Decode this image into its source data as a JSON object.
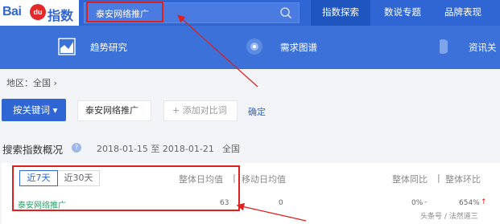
{
  "brand": {
    "bai": "Bai",
    "du": "du",
    "zhishu": "指数"
  },
  "search": {
    "value": "泰安网络推广"
  },
  "topnav": [
    {
      "label": "指数探索"
    },
    {
      "label": "数说专题"
    },
    {
      "label": "品牌表现"
    }
  ],
  "subnav": [
    {
      "label": "趋势研究"
    },
    {
      "label": "需求图谱"
    },
    {
      "label": "资讯关"
    }
  ],
  "region": {
    "label": "地区：全国 ›"
  },
  "controls": {
    "keyword_button": "按关键词 ▾",
    "keyword_chip": "泰安网络推广",
    "add_compare": "+ 添加对比词",
    "confirm": "确定"
  },
  "overview": {
    "title": "搜索指数概况",
    "date_range": "2018-01-15 至 2018-01-21",
    "area": "全国"
  },
  "table": {
    "tabs": [
      "近7天",
      "近30天"
    ],
    "headers": [
      "整体日均值",
      "|",
      "移动日均值",
      "整体同比",
      "|",
      "整体环比"
    ],
    "row": {
      "keyword": "泰安网络推广",
      "overall_avg": "63",
      "mobile_avg": "0",
      "yoy": "0%",
      "yoy_mark": "-",
      "mom": "654%",
      "mom_mark": "↑"
    }
  },
  "watermark": "头条号 / 法然道三",
  "colors": {
    "topbar": "#2f66d4",
    "subbar": "#3b71d8",
    "highlight": "#e0201f",
    "keyword_green": "#2e9c6a"
  }
}
